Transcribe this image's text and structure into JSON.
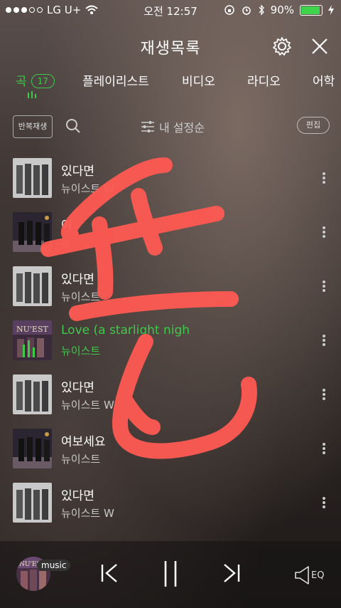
{
  "status": {
    "carrier": "LG U+",
    "time": "오전 12:57",
    "battery": "90%",
    "battery_level": 0.9
  },
  "header": {
    "title": "재생목록"
  },
  "tabs": [
    {
      "label": "곡",
      "badge": "17",
      "active": true
    },
    {
      "label": "플레이리스트"
    },
    {
      "label": "비디오"
    },
    {
      "label": "라디오"
    },
    {
      "label": "어학"
    }
  ],
  "controls": {
    "repeat_label": "반복재생",
    "sort_label": "내 설정순",
    "edit_label": "편집"
  },
  "songs": [
    {
      "title": "있다면",
      "artist": "뉴이스트 W"
    },
    {
      "title": "여",
      "artist": "뉴"
    },
    {
      "title": "있다면",
      "artist": "뉴이스트"
    },
    {
      "title": "Love (a starlight nigh",
      "artist": "뉴이스트",
      "playing": true
    },
    {
      "title": "있다면",
      "artist": "뉴이스트 W"
    },
    {
      "title": "여보세요",
      "artist": "뉴이스트"
    },
    {
      "title": "있다면",
      "artist": "뉴이스트 W"
    }
  ],
  "player": {
    "tag": "music",
    "eq_label": "EQ"
  },
  "colors": {
    "accent": "#3ec94b",
    "scribble": "#ff5a52"
  }
}
